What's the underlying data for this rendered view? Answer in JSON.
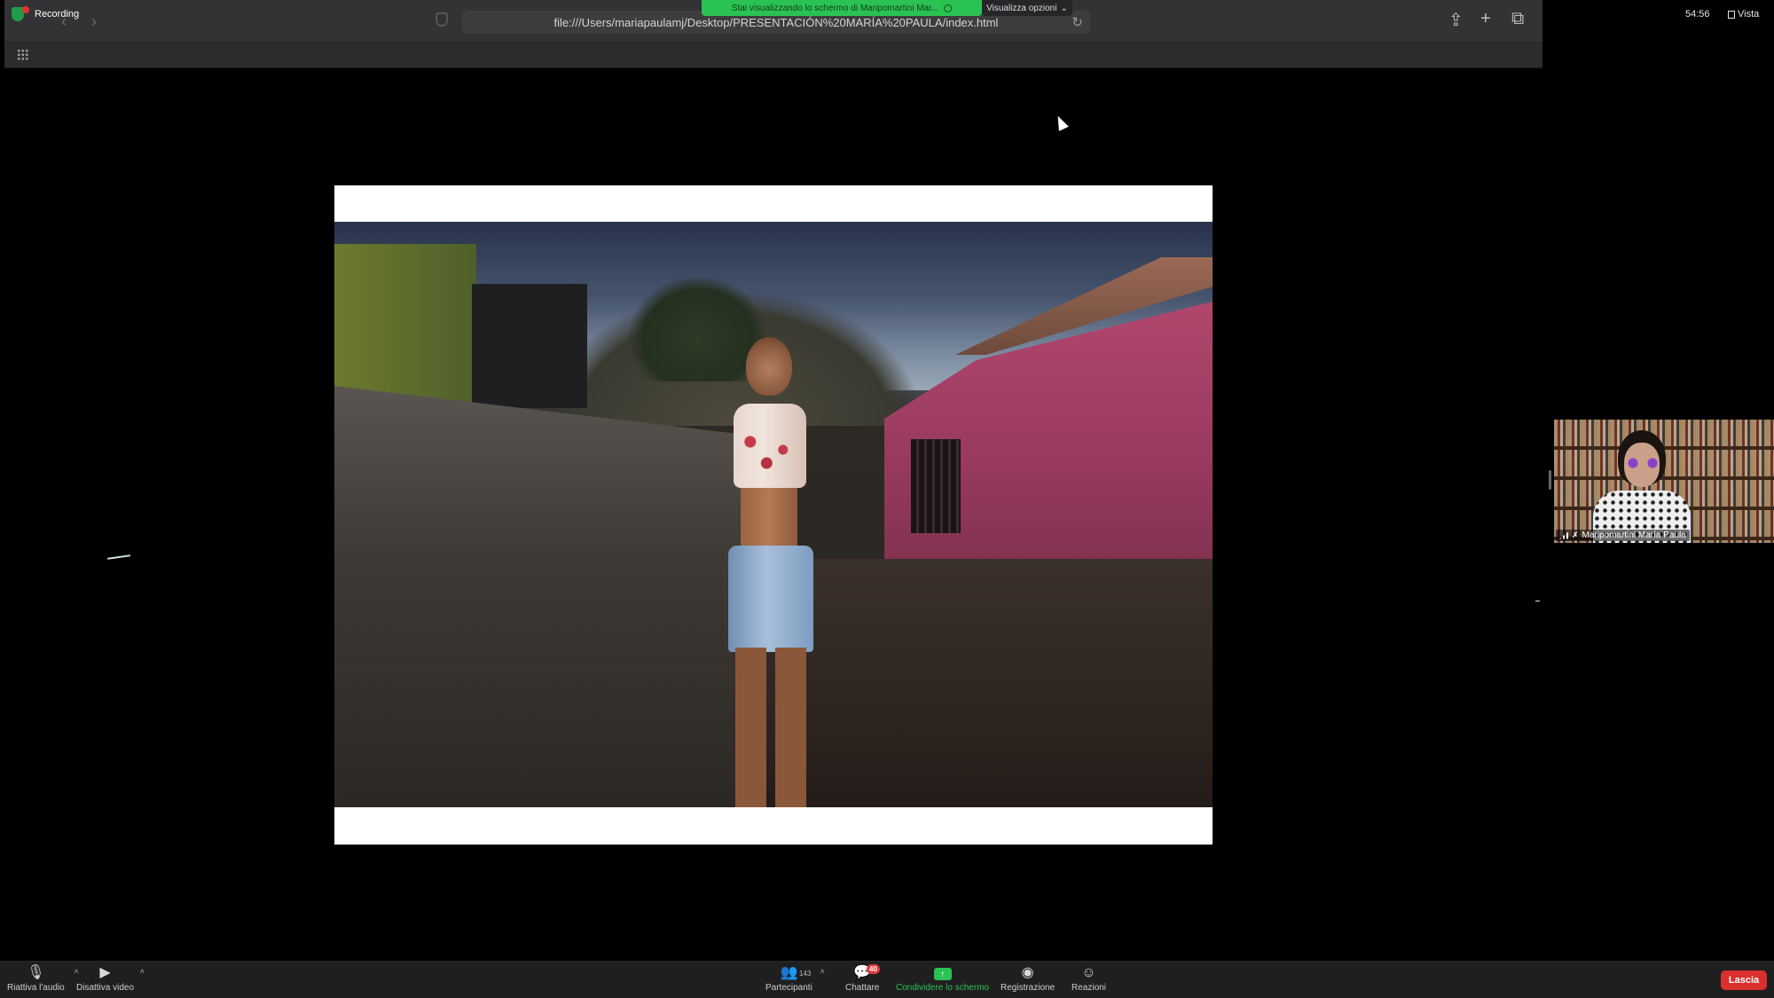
{
  "recording": {
    "label": "Recording"
  },
  "share_banner": {
    "text": "Stai visualizzando lo schermo di Maripomartini Mar...",
    "view_options": "Visualizza opzioni"
  },
  "browser": {
    "url": "file:///Users/mariapaulamj/Desktop/PRESENTACIÓN%20MARÍA%20PAULA/index.html"
  },
  "clock": "54:56",
  "view_button": {
    "label": "Vista"
  },
  "participant": {
    "name": "Maripomartini María Paula"
  },
  "toolbar": {
    "audio_label": "Riattiva l'audio",
    "video_label": "Disattiva video",
    "participants_label": "Partecipanti",
    "participants_count": "143",
    "chat_label": "Chattare",
    "chat_badge": "40",
    "share_label": "Condividere lo schermo",
    "record_label": "Registrazione",
    "reactions_label": "Reazioni",
    "leave_label": "Lascia"
  },
  "icons": {
    "security": "shield-icon",
    "participants": "people-icon",
    "chat": "chat-bubble-icon",
    "share": "share-screen-icon",
    "record": "record-icon",
    "reactions": "smiley-icon"
  },
  "colors": {
    "share_green": "#2bc254",
    "leave_red": "#d9302e",
    "badge_red": "#e03a3a"
  }
}
